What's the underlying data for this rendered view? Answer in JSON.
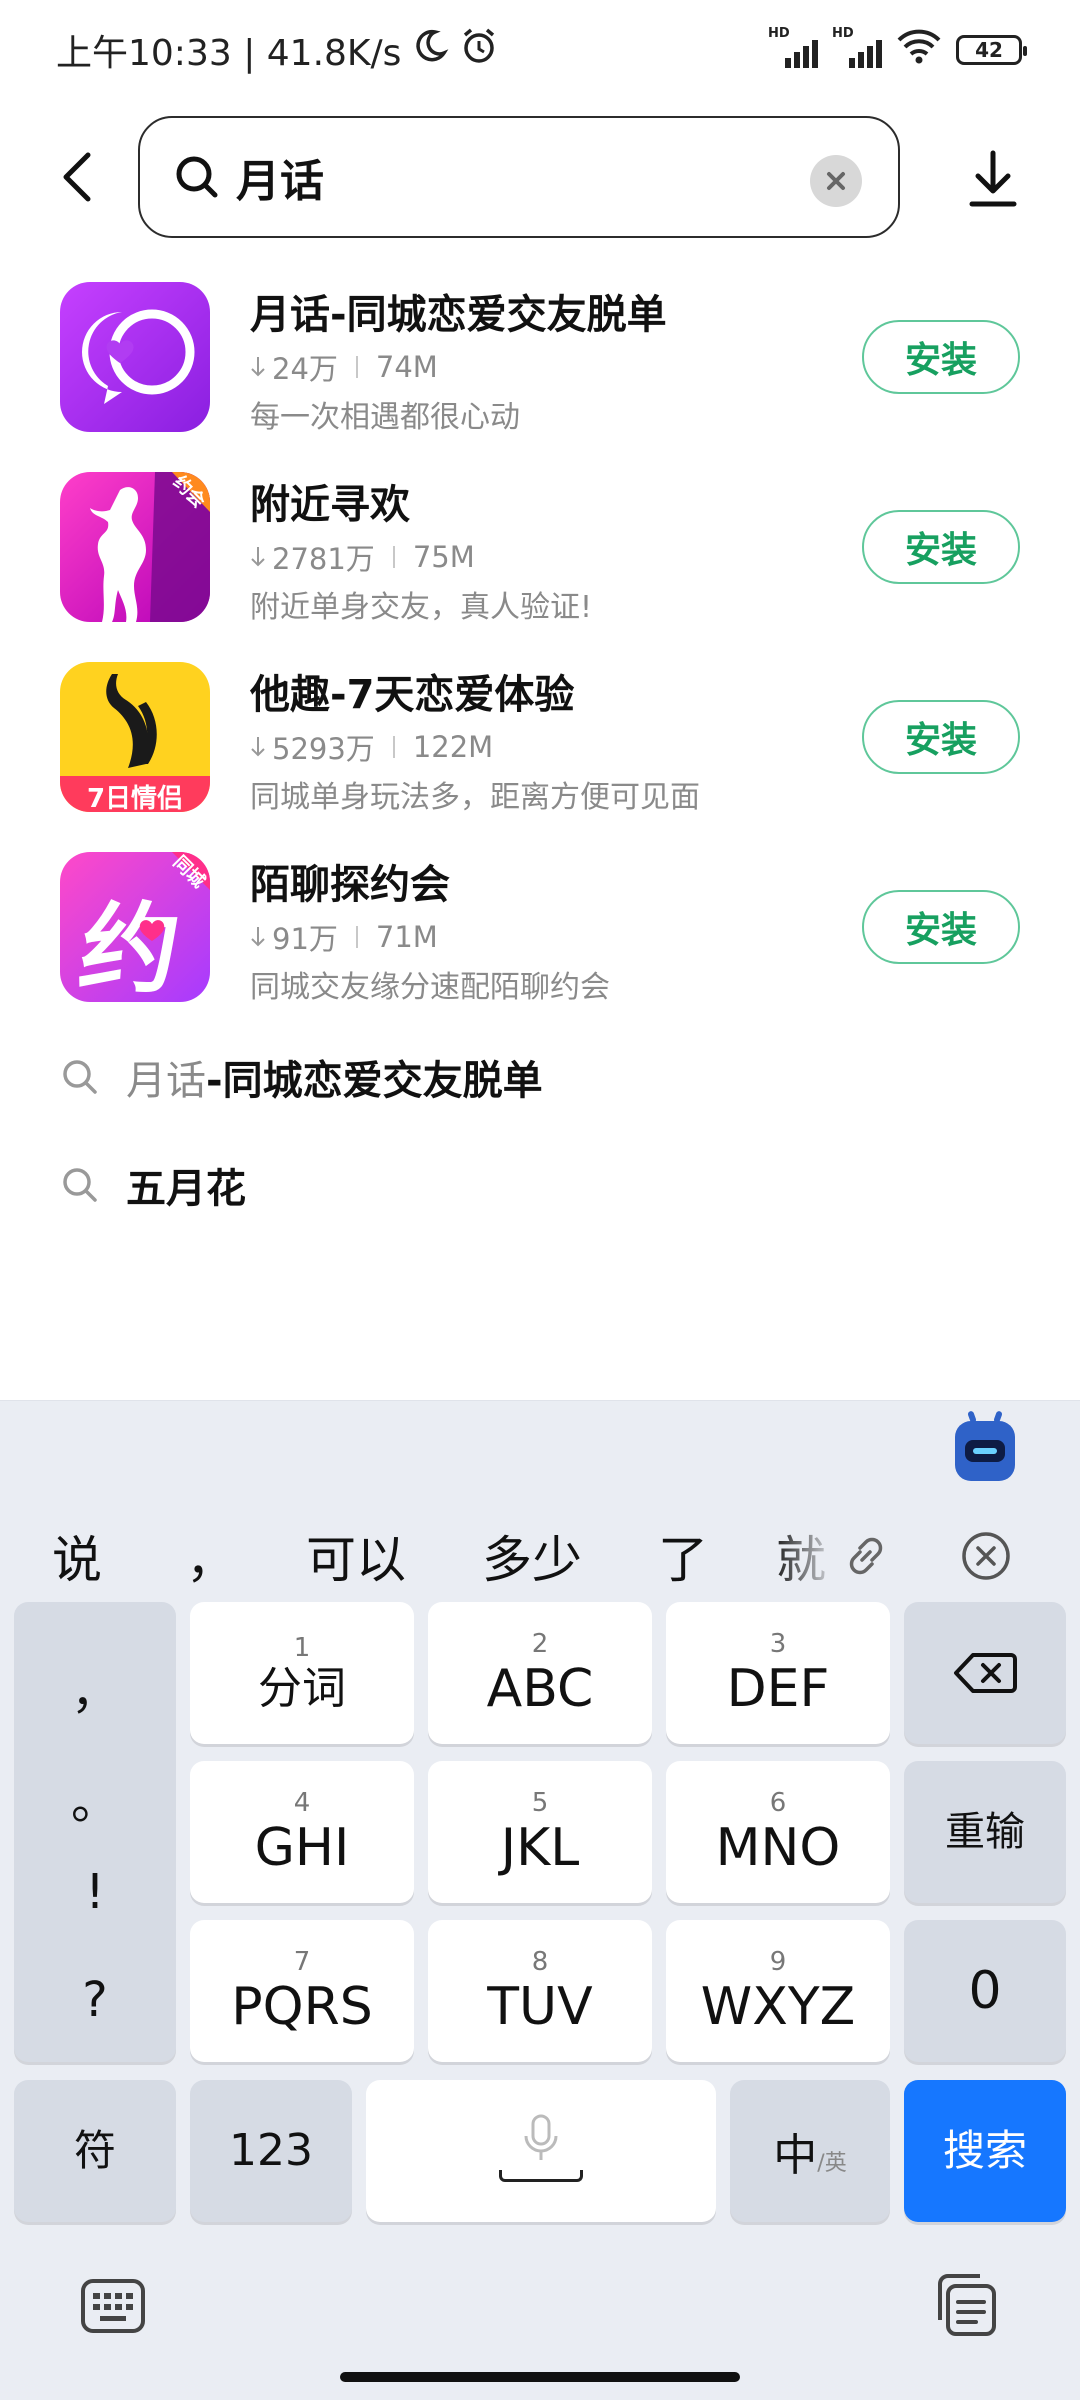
{
  "status_bar": {
    "time_speed": "上午10:33 | 41.8K/s",
    "signal_label": "HD",
    "battery": "42"
  },
  "search": {
    "query": "月话"
  },
  "apps": [
    {
      "title": "月话-同城恋爱交友脱单",
      "downloads": "24万",
      "size": "74M",
      "desc": "每一次相遇都很心动",
      "install": "安装"
    },
    {
      "title": "附近寻欢",
      "downloads": "2781万",
      "size": "75M",
      "desc": "附近单身交友，真人验证!",
      "install": "安装",
      "badge": "约会"
    },
    {
      "title": "他趣-7天恋爱体验",
      "downloads": "5293万",
      "size": "122M",
      "desc": "同城单身玩法多，距离方便可见面",
      "install": "安装",
      "badge": "7日情侣"
    },
    {
      "title": "陌聊探约会",
      "downloads": "91万",
      "size": "71M",
      "desc": "同城交友缘分速配陌聊约会",
      "install": "安装",
      "badge": "同城",
      "glyph": "约"
    }
  ],
  "suggestions": [
    {
      "highlight": "月话",
      "rest": "-同城恋爱交友脱单"
    },
    {
      "highlight": "",
      "rest": "五月花"
    }
  ],
  "keyboard": {
    "candidates": [
      "说",
      "，",
      "可以",
      "多少",
      "了",
      "就"
    ],
    "punctuation": [
      "，",
      "。",
      "!",
      "?"
    ],
    "keys": {
      "k1": {
        "num": "1",
        "label": "分词"
      },
      "k2": {
        "num": "2",
        "label": "ABC"
      },
      "k3": {
        "num": "3",
        "label": "DEF"
      },
      "k4": {
        "num": "4",
        "label": "GHI"
      },
      "k5": {
        "num": "5",
        "label": "JKL"
      },
      "k6": {
        "num": "6",
        "label": "MNO"
      },
      "k7": {
        "num": "7",
        "label": "PQRS"
      },
      "k8": {
        "num": "8",
        "label": "TUV"
      },
      "k9": {
        "num": "9",
        "label": "WXYZ"
      },
      "reinput": "重输",
      "zero": "0",
      "symbol": "符",
      "num123": "123",
      "lang_main": "中",
      "lang_sub": "/英",
      "search": "搜索"
    }
  },
  "colors": {
    "install_text": "#17a060",
    "install_border": "#5fc79a",
    "search_key": "#1677ff",
    "keyboard_bg": "#eaedf3"
  },
  "icons": [
    "back-icon",
    "search-icon",
    "clear-icon",
    "download-icon",
    "mic-icon",
    "link-icon",
    "close-candidates-icon",
    "backspace-icon",
    "keyboard-icon",
    "clipboard-icon",
    "assistant-robot-icon"
  ]
}
